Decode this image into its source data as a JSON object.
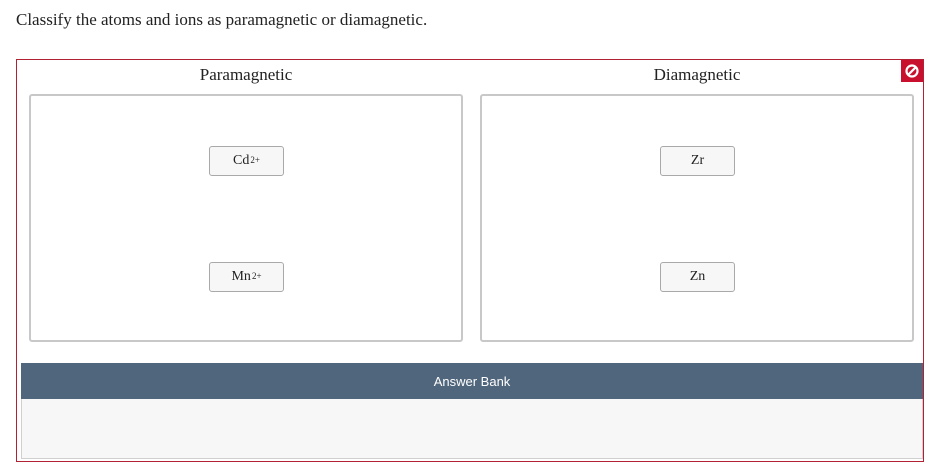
{
  "question": "Classify the atoms and ions as paramagnetic or diamagnetic.",
  "columns": {
    "paramagnetic": {
      "title": "Paramagnetic",
      "items": [
        {
          "base": "Cd",
          "charge": "2+"
        },
        {
          "base": "Mn",
          "charge": "2+"
        }
      ]
    },
    "diamagnetic": {
      "title": "Diamagnetic",
      "items": [
        {
          "base": "Zr",
          "charge": ""
        },
        {
          "base": "Zn",
          "charge": ""
        }
      ]
    }
  },
  "answer_bank": {
    "title": "Answer Bank"
  },
  "colors": {
    "frame_border": "#b22234",
    "status_icon": "#c8102e",
    "bank_header": "#50667d"
  },
  "icons": {
    "status": "prohibited-icon"
  }
}
